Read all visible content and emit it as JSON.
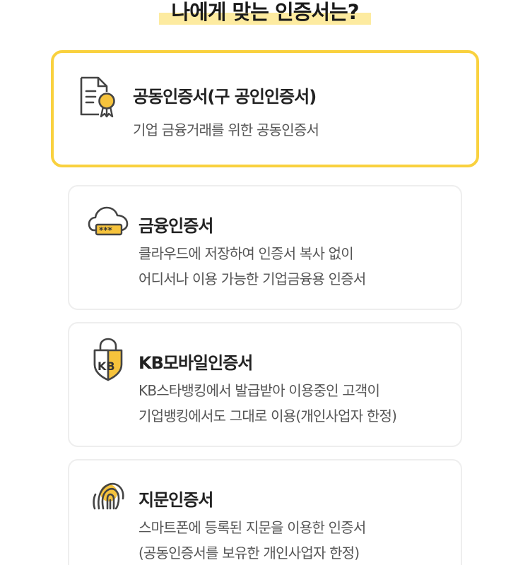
{
  "page": {
    "title": "나에게 맞는 인증서는?"
  },
  "certificates": [
    {
      "id": "joint",
      "icon": "certificate-document-icon",
      "title": "공동인증서(구 공인인증서)",
      "description": [
        "기업 금융거래를 위한 공동인증서"
      ],
      "selected": true
    },
    {
      "id": "financial",
      "icon": "cloud-password-icon",
      "title": "금융인증서",
      "description": [
        "클라우드에 저장하여 인증서 복사 없이",
        "어디서나 이용 가능한 기업금융용 인증서"
      ],
      "selected": false
    },
    {
      "id": "kb",
      "icon": "kb-shield-lock-icon",
      "title": "KB모바일인증서",
      "description": [
        "KB스타뱅킹에서 발급받아 이용중인 고객이",
        "기업뱅킹에서도 그대로 이용(개인사업자 한정)"
      ],
      "selected": false
    },
    {
      "id": "fingerprint",
      "icon": "fingerprint-icon",
      "title": "지문인증서",
      "description": [
        "스마트폰에 등록된 지문을 이용한 인증서",
        "(공동인증서를 보유한 개인사업자 한정)"
      ],
      "selected": false
    }
  ],
  "colors": {
    "accent": "#f9d13e",
    "highlight": "#fdeba0",
    "icon_stroke": "#444444",
    "card_border": "#eeeeee"
  }
}
